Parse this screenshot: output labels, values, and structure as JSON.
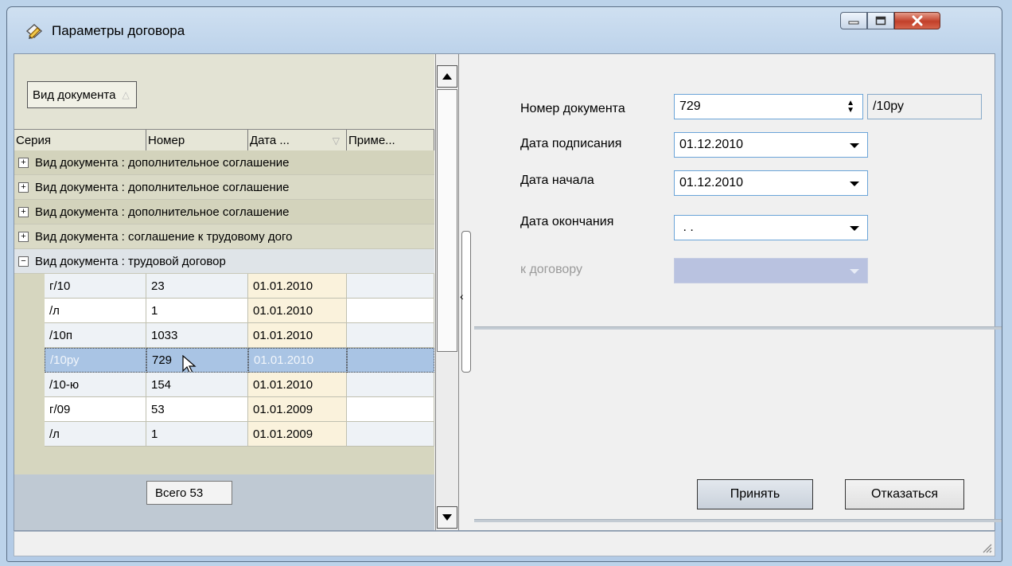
{
  "window": {
    "title": "Параметры договора",
    "icon": "document-pen-icon",
    "controls": [
      "minimize-icon",
      "maximize-icon",
      "close-icon"
    ]
  },
  "grid": {
    "group_chip": "Вид документа",
    "columns": [
      "Серия",
      "Номер",
      "Дата ...",
      "Приме..."
    ],
    "groups": [
      {
        "label": "Вид документа : дополнительное соглашение",
        "expanded": false
      },
      {
        "label": "Вид документа : дополнительное соглашение",
        "expanded": false
      },
      {
        "label": "Вид документа : дополнительное соглашение",
        "expanded": false
      },
      {
        "label": "Вид документа : соглашение к трудовому дого",
        "expanded": false
      },
      {
        "label": "Вид документа : трудовой договор",
        "expanded": true
      }
    ],
    "rows": [
      {
        "seria": "г/10",
        "nomer": "23",
        "data": "01.01.2010",
        "prim": ""
      },
      {
        "seria": "/л",
        "nomer": "1",
        "data": "01.01.2010",
        "prim": ""
      },
      {
        "seria": "/10п",
        "nomer": "1033",
        "data": "01.01.2010",
        "prim": ""
      },
      {
        "seria": "/10ру",
        "nomer": "729",
        "data": "01.01.2010",
        "prim": "",
        "selected": true
      },
      {
        "seria": "/10-ю",
        "nomer": "154",
        "data": "01.01.2010",
        "prim": ""
      },
      {
        "seria": "г/09",
        "nomer": "53",
        "data": "01.01.2009",
        "prim": ""
      },
      {
        "seria": "/л",
        "nomer": "1",
        "data": "01.01.2009",
        "prim": ""
      }
    ],
    "total": "Всего 53"
  },
  "form": {
    "doc_number_label": "Номер документа",
    "doc_number_value": "729",
    "doc_series_value": "/10ру",
    "sign_date_label": "Дата подписания",
    "sign_date_value": "01.12.2010",
    "start_date_label": "Дата начала",
    "start_date_value": "01.12.2010",
    "end_date_label": "Дата окончания",
    "end_date_value": " . .",
    "contract_label": "к договору",
    "contract_value": ""
  },
  "buttons": {
    "accept": "Принять",
    "cancel": "Отказаться"
  }
}
